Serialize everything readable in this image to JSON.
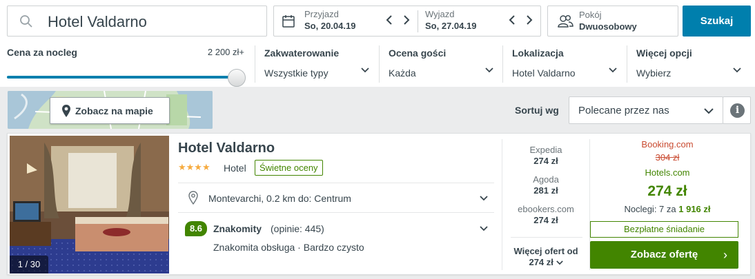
{
  "search": {
    "value": "Hotel Valdarno"
  },
  "dates": {
    "checkin_label": "Przyjazd",
    "checkin_value": "So, 20.04.19",
    "checkout_label": "Wyjazd",
    "checkout_value": "So, 27.04.19"
  },
  "room": {
    "label": "Pokój",
    "value": "Dwuosobowy"
  },
  "search_button": "Szukaj",
  "filters": {
    "price_label": "Cena za nocleg",
    "price_max": "2 200 zł+",
    "price_level_percent": 100,
    "columns": [
      {
        "label": "Zakwaterowanie",
        "value": "Wszystkie typy"
      },
      {
        "label": "Ocena gości",
        "value": "Każda"
      },
      {
        "label": "Lokalizacja",
        "value": "Hotel Valdarno"
      },
      {
        "label": "Więcej opcji",
        "value": "Wybierz"
      }
    ]
  },
  "map_button": "Zobacz na mapie",
  "sort": {
    "label": "Sortuj wg",
    "value": "Polecane przez nas",
    "info": "i"
  },
  "hotel": {
    "name": "Hotel Valdarno",
    "stars": "★★★★",
    "star_count": 4,
    "type": "Hotel",
    "badge": "Świetne oceny",
    "location": "Montevarchi, 0.2 km do: Centrum",
    "score": "8.6",
    "score_word": "Znakomity",
    "score_count": "(opinie: 445)",
    "review_tags": "Znakomita obsługa · Bardzo czysto",
    "photo_counter": "1 / 30"
  },
  "deals": [
    {
      "site": "Expedia",
      "price": "274 zł"
    },
    {
      "site": "Agoda",
      "price": "281 zł"
    },
    {
      "site": "ebookers.com",
      "price": "274 zł"
    }
  ],
  "more_offers": {
    "line1": "Więcej ofert od",
    "line2": "274 zł"
  },
  "best_offer": {
    "site1": "Booking.com",
    "old_price": "304 zł",
    "site2": "Hotels.com",
    "price": "274 zł",
    "nights_prefix": "Noclegi: 7 za",
    "nights_total": "1 916 zł",
    "breakfast": "Bezpłatne śniadanie",
    "cta": "Zobacz ofertę",
    "cta_arrow": "›"
  },
  "colors": {
    "accent_blue": "#007fad",
    "green": "#428500",
    "red": "#c94a30",
    "star": "#f6ab3f"
  }
}
